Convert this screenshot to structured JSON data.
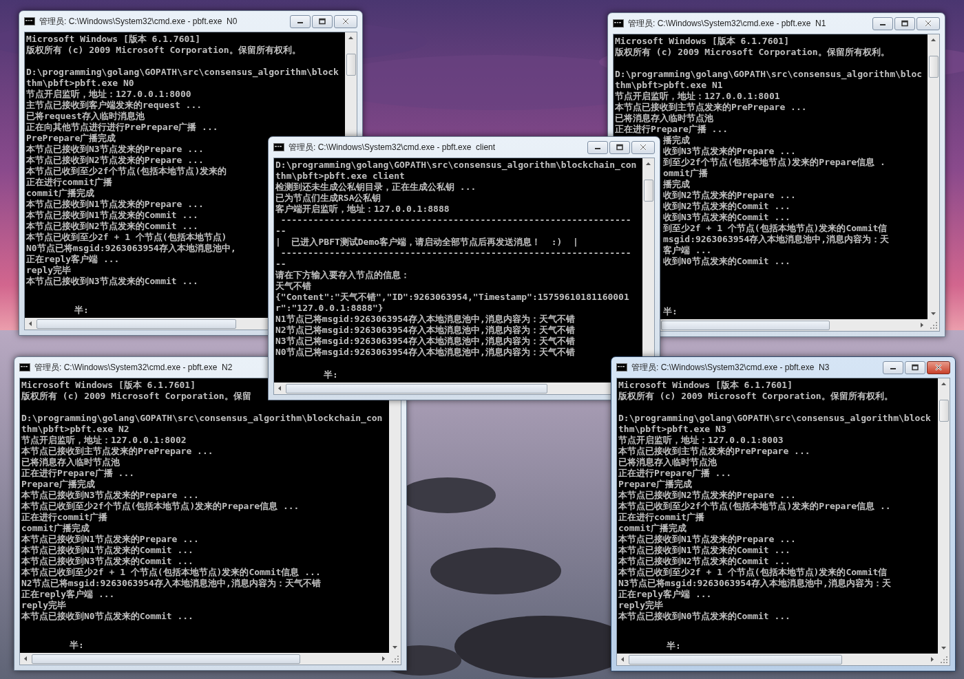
{
  "windows": [
    {
      "title": "管理员: C:\\Windows\\System32\\cmd.exe - pbft.exe  N0",
      "active": false,
      "header": [
        "Microsoft Windows [版本 6.1.7601]",
        "版权所有 (c) 2009 Microsoft Corporation。保留所有权利。"
      ],
      "lines": [
        "D:\\programming\\golang\\GOPATH\\src\\consensus_algorithm\\block",
        "thm\\pbft>pbft.exe N0",
        "节点开启监听，地址：127.0.0.1:8000",
        "主节点已接收到客户端发来的request ...",
        "已将request存入临时消息池",
        "正在向其他节点进行进行PrePrepare广播 ...",
        "PrePrepare广播完成",
        "本节点已接收到N3节点发来的Prepare ...",
        "本节点已接收到N2节点发来的Prepare ...",
        "本节点已收到至少2f个节点(包括本地节点)发来的",
        "正在进行commit广播",
        "commit广播完成",
        "本节点已接收到N1节点发来的Prepare ...",
        "本节点已接收到N1节点发来的Commit ...",
        "本节点已接收到N2节点发来的Commit ...",
        "本节点已收到至少2f + 1 个节点(包括本地节点)",
        "N0节点已将msgid:9263063954存入本地消息池中,",
        "正在reply客户端 ...",
        "reply完毕",
        "本节点已接收到N3节点发来的Commit ..."
      ],
      "ime_status": "半:"
    },
    {
      "title": "管理员: C:\\Windows\\System32\\cmd.exe - pbft.exe  N1",
      "active": false,
      "header": [
        "Microsoft Windows [版本 6.1.7601]",
        "版权所有 (c) 2009 Microsoft Corporation。保留所有权利。"
      ],
      "lines": [
        "D:\\programming\\golang\\GOPATH\\src\\consensus_algorithm\\bloc",
        "thm\\pbft>pbft.exe N1",
        "节点开启监听，地址：127.0.0.1:8001",
        "本节点已接收到主节点发来的PrePrepare ...",
        "已将消息存入临时节点池",
        "正在进行Prepare广播 ..."
      ],
      "partly_covered_lines": [
        "播完成",
        "收到N3节点发来的Prepare ...",
        "到至少2f个节点(包括本地节点)发来的Prepare信息 .",
        "ommit广播",
        "播完成",
        "收到N2节点发来的Prepare ...",
        "收到N2节点发来的Commit ...",
        "收到N3节点发来的Commit ...",
        "到至少2f + 1 个节点(包括本地节点)发来的Commit信",
        "msgid:9263063954存入本地消息池中,消息内容为：天",
        "客户端 ...",
        "收到N0节点发来的Commit ..."
      ],
      "ime_status": "半:"
    },
    {
      "title": "管理员: C:\\Windows\\System32\\cmd.exe - pbft.exe  N2",
      "active": false,
      "header": [
        "Microsoft Windows [版本 6.1.7601]",
        "版权所有 (c) 2009 Microsoft Corporation。保留"
      ],
      "lines": [
        "D:\\programming\\golang\\GOPATH\\src\\consensus_algorithm\\blockchain_con",
        "thm\\pbft>pbft.exe N2",
        "节点开启监听，地址：127.0.0.1:8002",
        "本节点已接收到主节点发来的PrePrepare ...",
        "已将消息存入临时节点池",
        "正在进行Prepare广播 ...",
        "Prepare广播完成",
        "本节点已接收到N3节点发来的Prepare ...",
        "本节点已收到至少2f个节点(包括本地节点)发来的Prepare信息 ...",
        "正在进行commit广播",
        "commit广播完成",
        "本节点已接收到N1节点发来的Prepare ...",
        "本节点已接收到N1节点发来的Commit ...",
        "本节点已接收到N3节点发来的Commit ...",
        "本节点已收到至少2f + 1 个节点(包括本地节点)发来的Commit信息 ...",
        "N2节点已将msgid:9263063954存入本地消息池中,消息内容为：天气不错",
        "正在reply客户端 ...",
        "reply完毕",
        "本节点已接收到N0节点发来的Commit ..."
      ],
      "ime_status": "半:"
    },
    {
      "title": "管理员: C:\\Windows\\System32\\cmd.exe - pbft.exe  client",
      "active": false,
      "lines": [
        "D:\\programming\\golang\\GOPATH\\src\\consensus_algorithm\\blockchain_con",
        "thm\\pbft>pbft.exe client",
        "检测到还未生成公私钥目录，正在生成公私钥 ...",
        "已为节点们生成RSA公私钥",
        "客户端开启监听，地址：127.0.0.1:8888",
        " -----------------------------------------------------------------",
        "--",
        "|  已进入PBFT测试Demo客户端，请启动全部节点后再发送消息！  :)  |",
        " -----------------------------------------------------------------",
        "--",
        "请在下方输入要存入节点的信息：",
        "天气不错",
        "{\"Content\":\"天气不错\",\"ID\":9263063954,\"Timestamp\":15759610181160001",
        "r\":\"127.0.0.1:8888\"}",
        "N1节点已将msgid:9263063954存入本地消息池中,消息内容为：天气不错",
        "N2节点已将msgid:9263063954存入本地消息池中,消息内容为：天气不错",
        "N3节点已将msgid:9263063954存入本地消息池中,消息内容为：天气不错",
        "N0节点已将msgid:9263063954存入本地消息池中,消息内容为：天气不错"
      ],
      "ime_status": "半:"
    },
    {
      "title": "管理员: C:\\Windows\\System32\\cmd.exe - pbft.exe  N3",
      "active": true,
      "header": [
        "Microsoft Windows [版本 6.1.7601]",
        "版权所有 (c) 2009 Microsoft Corporation。保留所有权利。"
      ],
      "lines": [
        "D:\\programming\\golang\\GOPATH\\src\\consensus_algorithm\\block",
        "thm\\pbft>pbft.exe N3",
        "节点开启监听，地址：127.0.0.1:8003",
        "本节点已接收到主节点发来的PrePrepare ...",
        "已将消息存入临时节点池",
        "正在进行Prepare广播 ...",
        "Prepare广播完成",
        "本节点已接收到N2节点发来的Prepare ...",
        "本节点已收到至少2f个节点(包括本地节点)发来的Prepare信息 ..",
        "正在进行commit广播",
        "commit广播完成",
        "本节点已接收到N1节点发来的Prepare ...",
        "本节点已接收到N1节点发来的Commit ...",
        "本节点已接收到N2节点发来的Commit ...",
        "本节点已收到至少2f + 1 个节点(包括本地节点)发来的Commit信",
        "N3节点已将msgid:9263063954存入本地消息池中,消息内容为：天",
        "正在reply客户端 ...",
        "reply完毕",
        "本节点已接收到N0节点发来的Commit ..."
      ],
      "ime_status": "半:"
    }
  ]
}
